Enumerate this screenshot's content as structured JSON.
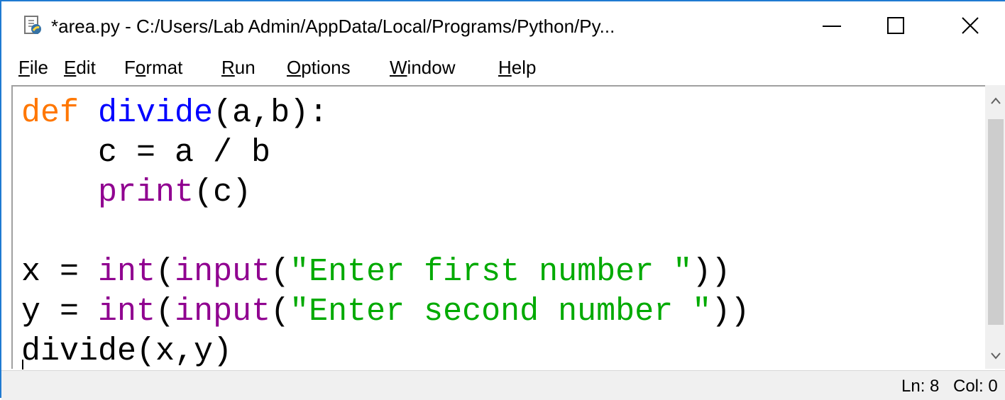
{
  "window": {
    "title": "*area.py - C:/Users/Lab Admin/AppData/Local/Programs/Python/Py...",
    "app_icon": "python-file-icon",
    "controls": {
      "minimize": "minimize-icon",
      "maximize": "maximize-icon",
      "close": "close-icon"
    }
  },
  "menu": [
    {
      "mnemonic": "F",
      "rest": "ile"
    },
    {
      "mnemonic": "E",
      "rest": "dit"
    },
    {
      "pre": "F",
      "mnemonic": "o",
      "rest": "rmat"
    },
    {
      "mnemonic": "R",
      "rest": "un"
    },
    {
      "mnemonic": "O",
      "rest": "ptions"
    },
    {
      "mnemonic": "W",
      "rest": "indow"
    },
    {
      "mnemonic": "H",
      "rest": "elp"
    }
  ],
  "code": {
    "l1": {
      "kw": "def",
      "fn": "divide",
      "rest": "(a,b):"
    },
    "l2": "    c = a / b",
    "l3": {
      "indent": "    ",
      "bi": "print",
      "rest": "(c)"
    },
    "l5": {
      "pre": "x = ",
      "bi1": "int",
      "p1": "(",
      "bi2": "input",
      "p2": "(",
      "str": "\"Enter first number \"",
      "post": "))"
    },
    "l6": {
      "pre": "y = ",
      "bi1": "int",
      "p1": "(",
      "bi2": "input",
      "p2": "(",
      "str": "\"Enter second number \"",
      "post": "))"
    },
    "l7": "divide(x,y)"
  },
  "status": {
    "ln": "Ln: 8",
    "col": "Col: 0"
  },
  "colors": {
    "keyword": "#ff7700",
    "definition": "#0000ff",
    "builtin": "#900090",
    "string": "#00aa00",
    "border": "#1f7ad1"
  }
}
